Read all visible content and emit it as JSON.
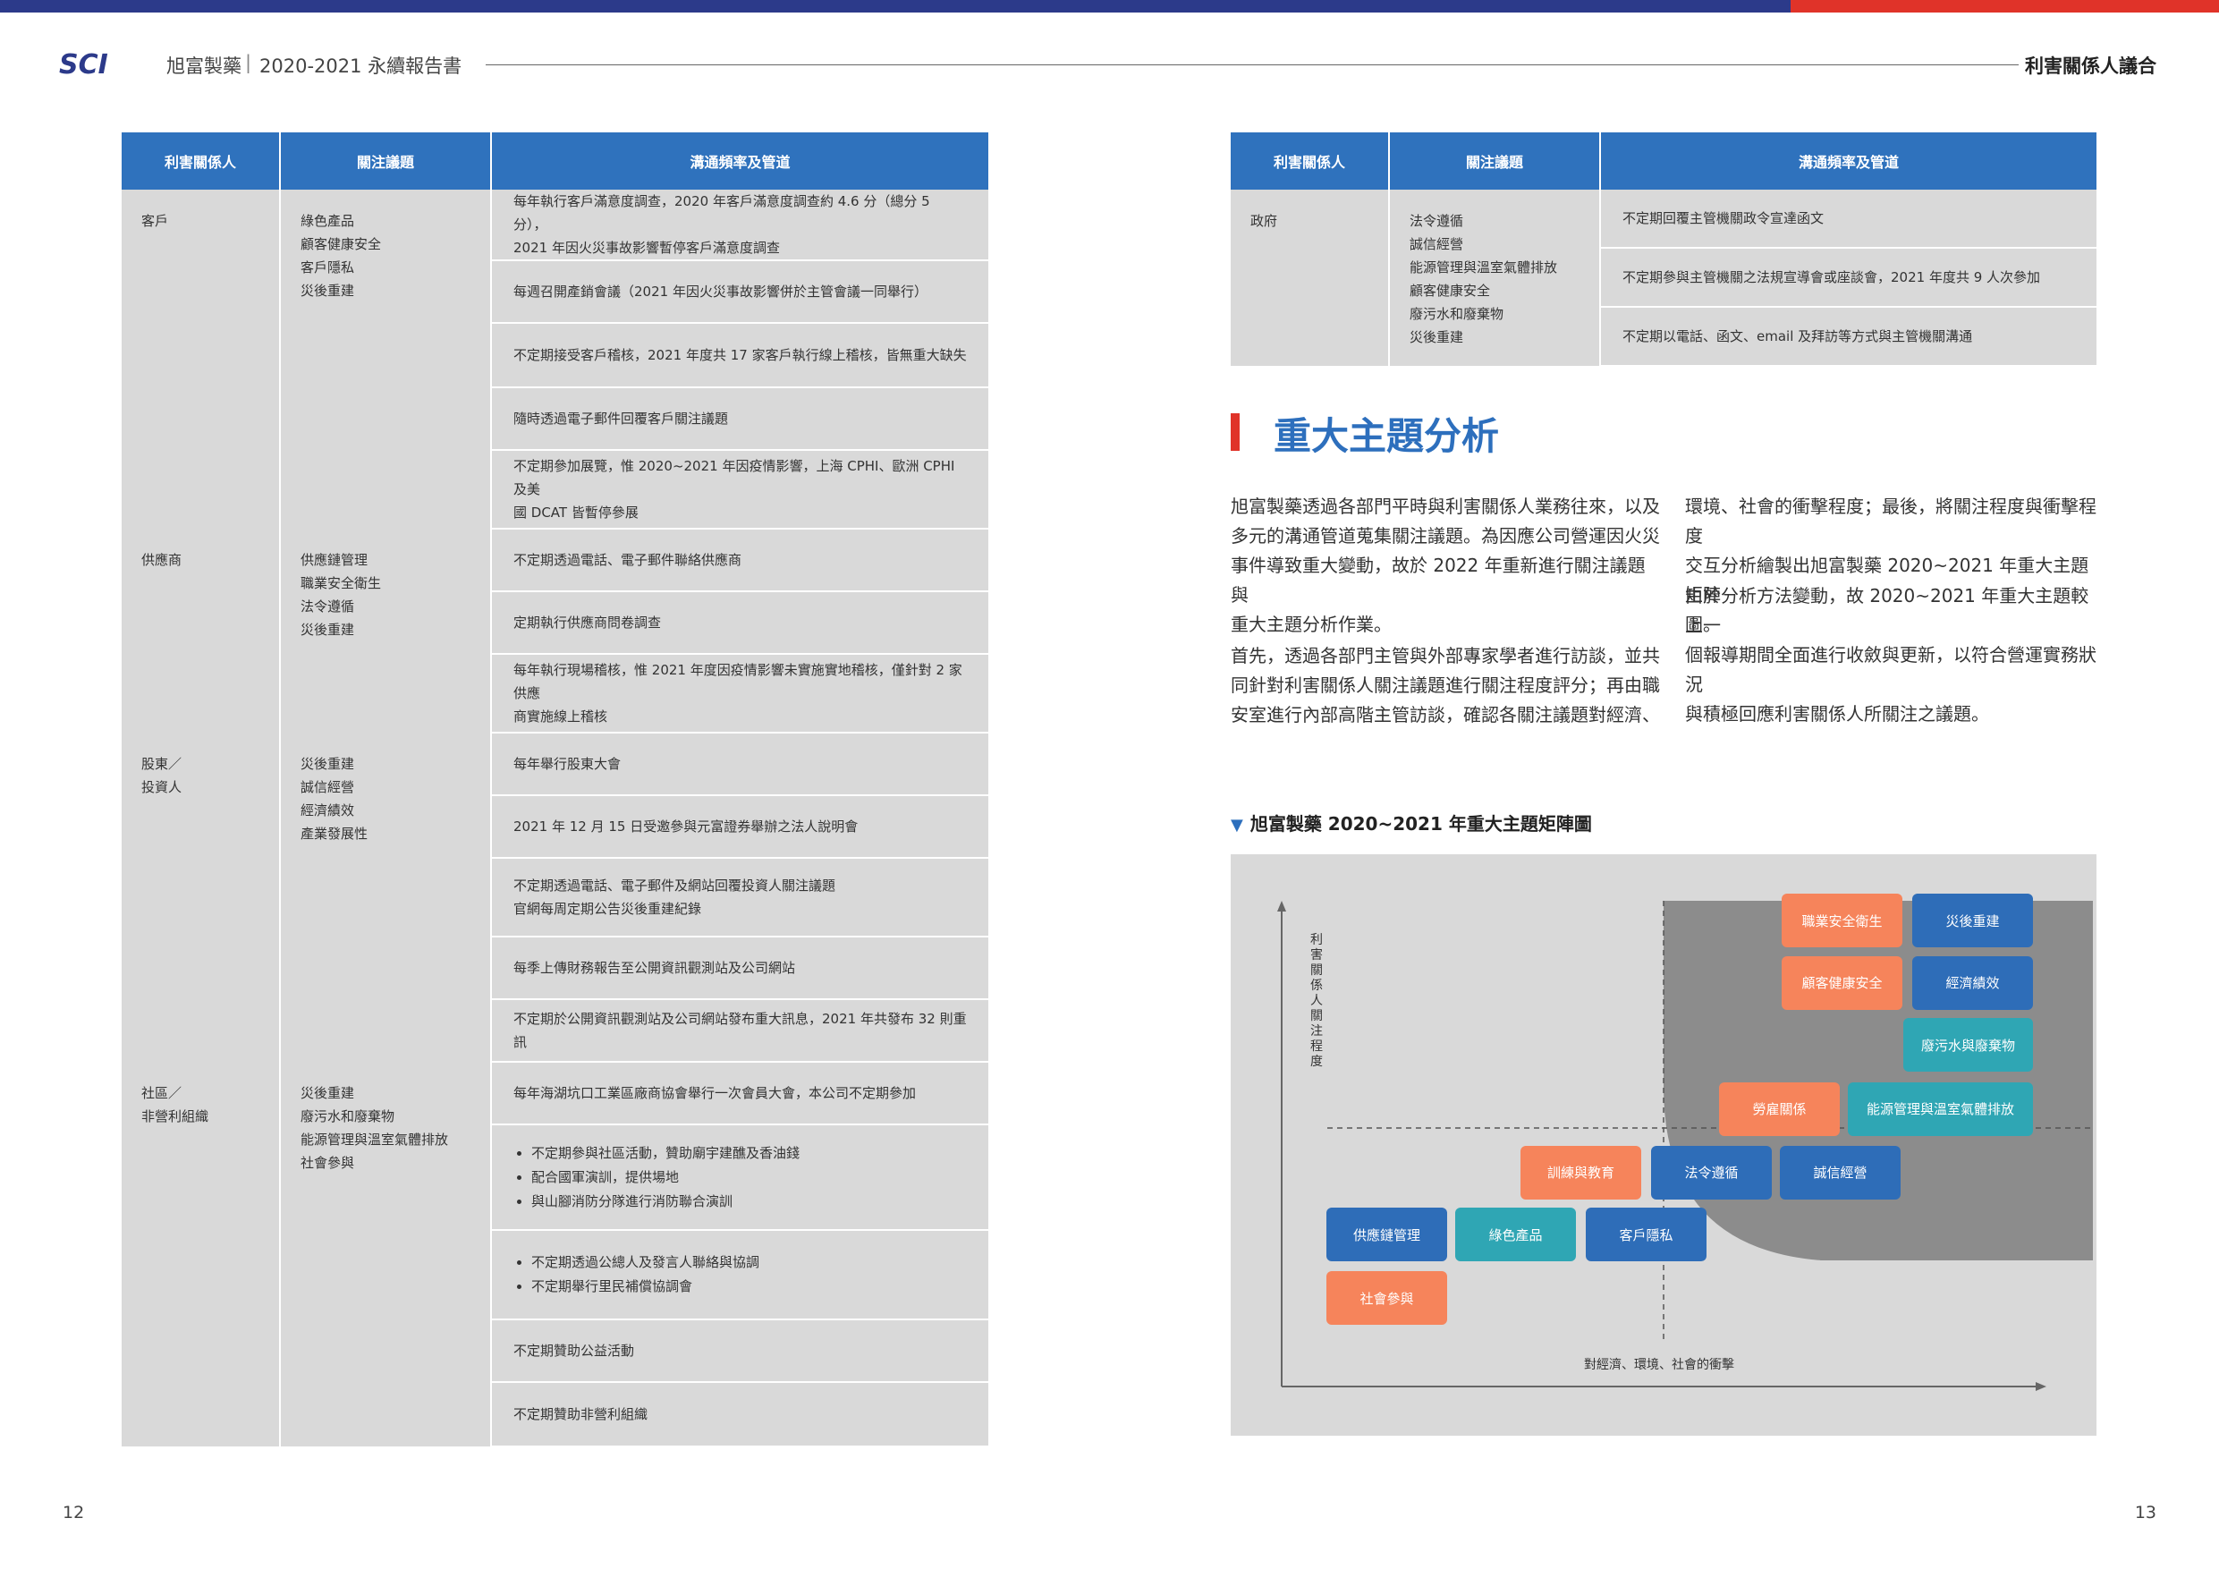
{
  "header": {
    "logo": "SCI",
    "company": "旭富製藥",
    "separator": "|",
    "report": "2020-2021 永續報告書",
    "section": "利害關係人議合"
  },
  "page_numbers": {
    "left": "12",
    "right": "13"
  },
  "table_headers": {
    "stakeholder": "利害關係人",
    "issues": "關注議題",
    "channels": "溝通頻率及管道"
  },
  "left_table": [
    {
      "stakeholder": [
        "客戶"
      ],
      "issues": [
        "綠色產品",
        "顧客健康安全",
        "客戶隱私",
        "災後重建"
      ],
      "channels": [
        {
          "text": [
            "每年執行客戶滿意度調查，2020 年客戶滿意度調查約 4.6 分（總分 5 分），",
            "2021 年因火災事故影響暫停客戶滿意度調查"
          ]
        },
        {
          "text": [
            "每週召開產銷會議（2021 年因火災事故影響併於主管會議一同舉行）"
          ]
        },
        {
          "text": [
            "不定期接受客戶稽核，2021 年度共 17 家客戶執行線上稽核，皆無重大缺失"
          ]
        },
        {
          "text": [
            "隨時透過電子郵件回覆客戶關注議題"
          ]
        },
        {
          "text": [
            "不定期參加展覽，惟 2020~2021 年因疫情影響，上海 CPHI、歐洲 CPHI 及美",
            "國 DCAT 皆暫停參展"
          ]
        }
      ]
    },
    {
      "stakeholder": [
        "供應商"
      ],
      "issues": [
        "供應鏈管理",
        "職業安全衛生",
        "法令遵循",
        "災後重建"
      ],
      "channels": [
        {
          "text": [
            "不定期透過電話、電子郵件聯絡供應商"
          ]
        },
        {
          "text": [
            "定期執行供應商問卷調查"
          ]
        },
        {
          "text": [
            "每年執行現場稽核，惟 2021 年度因疫情影響未實施實地稽核，僅針對 2 家供應",
            "商實施線上稽核"
          ]
        }
      ]
    },
    {
      "stakeholder": [
        "股東／",
        "投資人"
      ],
      "issues": [
        "災後重建",
        "誠信經營",
        "經濟績效",
        "產業發展性"
      ],
      "channels": [
        {
          "text": [
            "每年舉行股東大會"
          ]
        },
        {
          "text": [
            "2021 年 12 月 15 日受邀參與元富證券舉辦之法人說明會"
          ]
        },
        {
          "text": [
            "不定期透過電話、電子郵件及網站回覆投資人關注議題",
            "官網每周定期公告災後重建紀錄"
          ]
        },
        {
          "text": [
            "每季上傳財務報告至公開資訊觀測站及公司網站"
          ]
        },
        {
          "text": [
            "不定期於公開資訊觀測站及公司網站發布重大訊息，2021 年共發布 32 則重訊"
          ]
        }
      ]
    },
    {
      "stakeholder": [
        "社區／",
        "非營利組織"
      ],
      "issues": [
        "災後重建",
        "廢污水和廢棄物",
        "能源管理與溫室氣體排放",
        "社會參與"
      ],
      "channels": [
        {
          "text": [
            "每年海湖坑口工業區廠商協會舉行一次會員大會，本公司不定期參加"
          ]
        },
        {
          "bullets": [
            "不定期參與社區活動，贊助廟宇建醮及香油錢",
            "配合國軍演訓，提供場地",
            "與山腳消防分隊進行消防聯合演訓"
          ]
        },
        {
          "bullets": [
            "不定期透過公總人及發言人聯絡與協調",
            "不定期舉行里民補償協調會"
          ]
        },
        {
          "text": [
            "不定期贊助公益活動"
          ]
        },
        {
          "text": [
            "不定期贊助非營利組織"
          ]
        }
      ]
    }
  ],
  "right_table": [
    {
      "stakeholder": [
        "政府"
      ],
      "issues": [
        "法令遵循",
        "誠信經營",
        "能源管理與溫室氣體排放",
        "顧客健康安全",
        "廢污水和廢棄物",
        "災後重建"
      ],
      "channels": [
        {
          "text": [
            "不定期回覆主管機關政令宣達函文"
          ]
        },
        {
          "text": [
            "不定期參與主管機關之法規宣導會或座談會，2021 年度共 9 人次參加"
          ]
        },
        {
          "text": [
            "不定期以電話、函文、email 及拜訪等方式與主管機關溝通"
          ]
        }
      ]
    }
  ],
  "section_title": "重大主題分析",
  "paragraphs": {
    "p1": [
      "旭富製藥透過各部門平時與利害關係人業務往來，以及",
      "多元的溝通管道蒐集關注議題。為因應公司營運因火災",
      "事件導致重大變動，故於 2022 年重新進行關注議題與",
      "重大主題分析作業。"
    ],
    "p2": [
      "首先，透過各部門主管與外部專家學者進行訪談，並共",
      "同針對利害關係人關注議題進行關注程度評分；再由職",
      "安室進行內部高階主管訪談，確認各關注議題對經濟、"
    ],
    "p3": [
      "環境、社會的衝擊程度；最後，將關注程度與衝擊程度",
      "交互分析繪製出旭富製藥 2020~2021 年重大主題矩陣",
      "圖。"
    ],
    "p4": [
      "由於分析方法變動，故 2020~2021 年重大主題較上一",
      "個報導期間全面進行收斂與更新，以符合營運實務狀況",
      "與積極回應利害關係人所關注之議題。"
    ]
  },
  "matrix": {
    "title": "旭富製藥 2020~2021 年重大主題矩陣圖",
    "y_label": "利害關係人關注程度",
    "x_label": "對經濟、環境、社會的衝擊",
    "colors": {
      "orange": "#f6845b",
      "blue": "#2e6db8",
      "teal": "#2fa6b4",
      "highlight": "#8c8c8c"
    },
    "items": [
      {
        "label": "職業安全衛生",
        "color": "orange"
      },
      {
        "label": "災後重建",
        "color": "blue"
      },
      {
        "label": "顧客健康安全",
        "color": "orange"
      },
      {
        "label": "經濟績效",
        "color": "blue"
      },
      {
        "label": "廢污水與廢棄物",
        "color": "teal"
      },
      {
        "label": "勞雇關係",
        "color": "orange"
      },
      {
        "label": "能源管理與溫室氣體排放",
        "color": "teal"
      },
      {
        "label": "訓練與教育",
        "color": "orange"
      },
      {
        "label": "法令遵循",
        "color": "blue"
      },
      {
        "label": "誠信經營",
        "color": "blue"
      },
      {
        "label": "供應鏈管理",
        "color": "blue"
      },
      {
        "label": "綠色產品",
        "color": "teal"
      },
      {
        "label": "客戶隱私",
        "color": "blue"
      },
      {
        "label": "社會參與",
        "color": "orange"
      }
    ]
  }
}
